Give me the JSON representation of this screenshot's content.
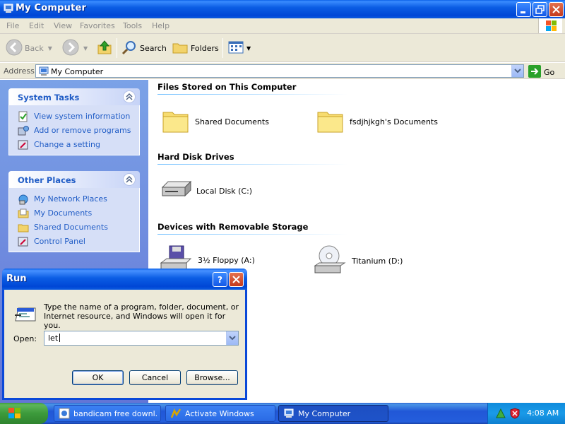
{
  "window": {
    "title": "My Computer",
    "menu": [
      "File",
      "Edit",
      "View",
      "Favorites",
      "Tools",
      "Help"
    ],
    "toolbar": {
      "back": "Back",
      "search": "Search",
      "folders": "Folders"
    },
    "address": {
      "label": "Address",
      "value": "My Computer",
      "go": "Go"
    }
  },
  "taskpane": {
    "system_tasks": {
      "title": "System Tasks",
      "items": [
        "View system information",
        "Add or remove programs",
        "Change a setting"
      ]
    },
    "other_places": {
      "title": "Other Places",
      "items": [
        "My Network Places",
        "My Documents",
        "Shared Documents",
        "Control Panel"
      ]
    }
  },
  "content": {
    "files_group": {
      "title": "Files Stored on This Computer",
      "items": [
        "Shared Documents",
        "fsdjhjkgh's Documents"
      ]
    },
    "hdd_group": {
      "title": "Hard Disk Drives",
      "items": [
        "Local Disk (C:)"
      ]
    },
    "removable_group": {
      "title": "Devices with Removable Storage",
      "items": [
        "3½ Floppy (A:)",
        "Titanium (D:)"
      ]
    }
  },
  "run_dialog": {
    "title": "Run",
    "description": "Type the name of a program, folder, document, or Internet resource, and Windows will open it for you.",
    "open_label": "Open:",
    "open_value": "let",
    "ok": "OK",
    "cancel": "Cancel",
    "browse": "Browse..."
  },
  "taskbar": {
    "tasks": [
      "bandicam free downl...",
      "Activate Windows",
      "My Computer"
    ],
    "clock": "4:08 AM"
  },
  "colors": {
    "xp_blue": "#0046d6",
    "task_link": "#215dc6",
    "start_green": "#3c9a3b"
  }
}
